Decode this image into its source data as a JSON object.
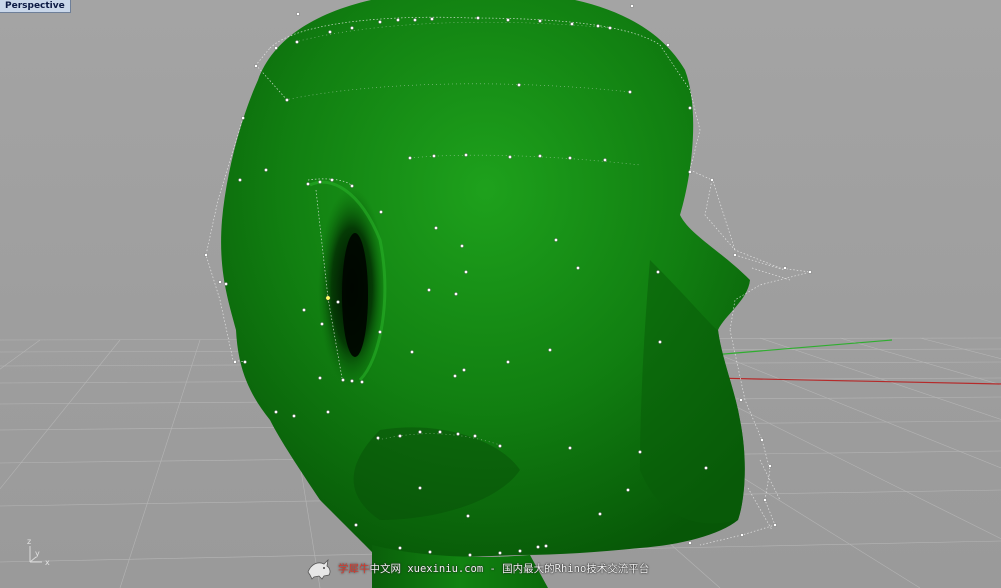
{
  "viewport": {
    "title": "Perspective",
    "background": "#9e9e9e",
    "grid_color": "#b6b6b6",
    "x_axis_color": "#b52727",
    "y_axis_color": "#2b9e2b"
  },
  "model": {
    "surface_color": "#0f7a10",
    "highlight_color": "#1ea11c",
    "control_point_color": "#ffffff",
    "selected_point_color": "#ffff66"
  },
  "axis_indicator": {
    "z_label": "z",
    "y_label": "y",
    "x_label": "x"
  },
  "watermark": {
    "brand": "学犀牛",
    "site": "中文网 xuexiniu.com",
    "slogan": " - 国内最大的Rhino技术交流平台",
    "logo_icon": "rhino-logo-icon"
  }
}
